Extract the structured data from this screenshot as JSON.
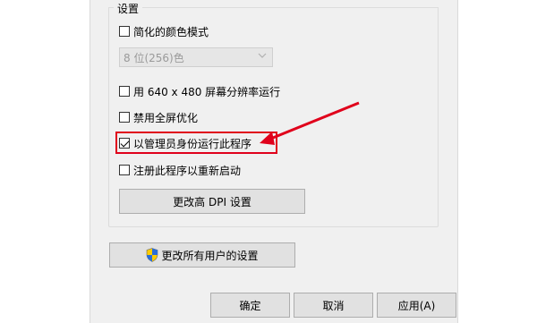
{
  "group": {
    "title": "设置"
  },
  "options": {
    "reduced_color": {
      "label": "简化的颜色模式",
      "checked": false
    },
    "color_select": {
      "value": "8 位(256)色"
    },
    "low_res": {
      "label": "用 640 x 480 屏幕分辨率运行",
      "checked": false
    },
    "disable_fullscreen_opt": {
      "label": "禁用全屏优化",
      "checked": false
    },
    "run_as_admin": {
      "label": "以管理员身份运行此程序",
      "checked": true
    },
    "register_restart": {
      "label": "注册此程序以重新启动",
      "checked": false
    }
  },
  "buttons": {
    "dpi": "更改高 DPI 设置",
    "all_users": "更改所有用户的设置",
    "ok": "确定",
    "cancel": "取消",
    "apply": "应用(A)"
  },
  "annotation": {
    "color": "#e0001b"
  }
}
